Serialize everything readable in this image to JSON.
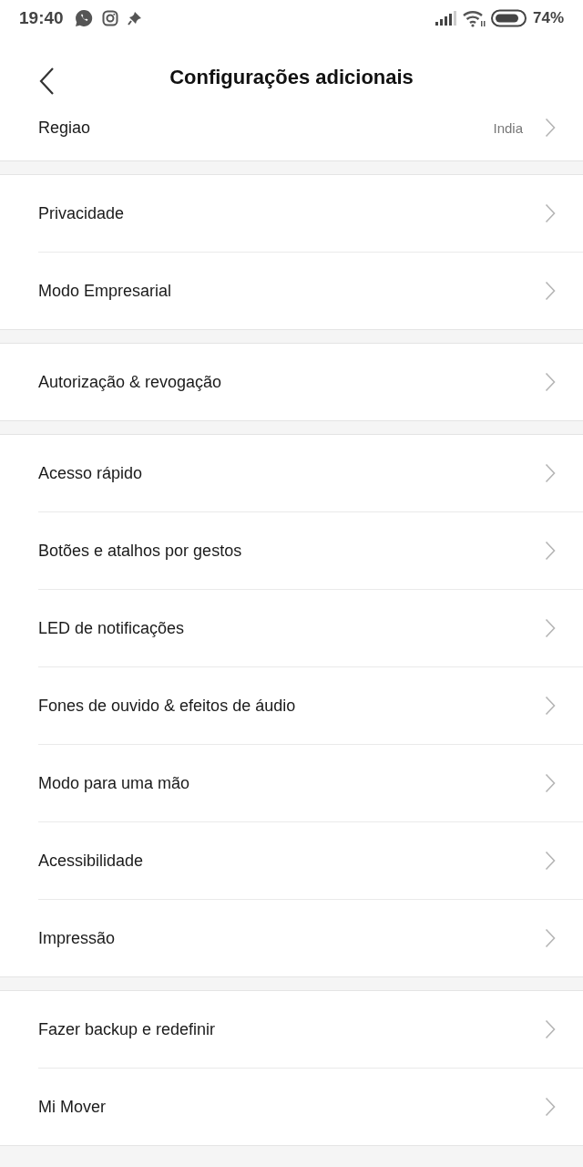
{
  "status_bar": {
    "time": "19:40",
    "battery": "74%"
  },
  "header": {
    "title": "Configurações adicionais"
  },
  "sections": [
    {
      "items": [
        {
          "label": "Regiao",
          "value": "India"
        }
      ]
    },
    {
      "items": [
        {
          "label": "Privacidade"
        },
        {
          "label": "Modo Empresarial"
        }
      ]
    },
    {
      "items": [
        {
          "label": "Autorização & revogação"
        }
      ]
    },
    {
      "items": [
        {
          "label": "Acesso rápido"
        },
        {
          "label": "Botões e atalhos por gestos"
        },
        {
          "label": "LED de notificações"
        },
        {
          "label": "Fones de ouvido & efeitos de áudio"
        },
        {
          "label": "Modo para uma mão"
        },
        {
          "label": "Acessibilidade"
        },
        {
          "label": "Impressão"
        }
      ]
    },
    {
      "items": [
        {
          "label": "Fazer backup e redefinir"
        },
        {
          "label": "Mi Mover"
        }
      ]
    }
  ]
}
